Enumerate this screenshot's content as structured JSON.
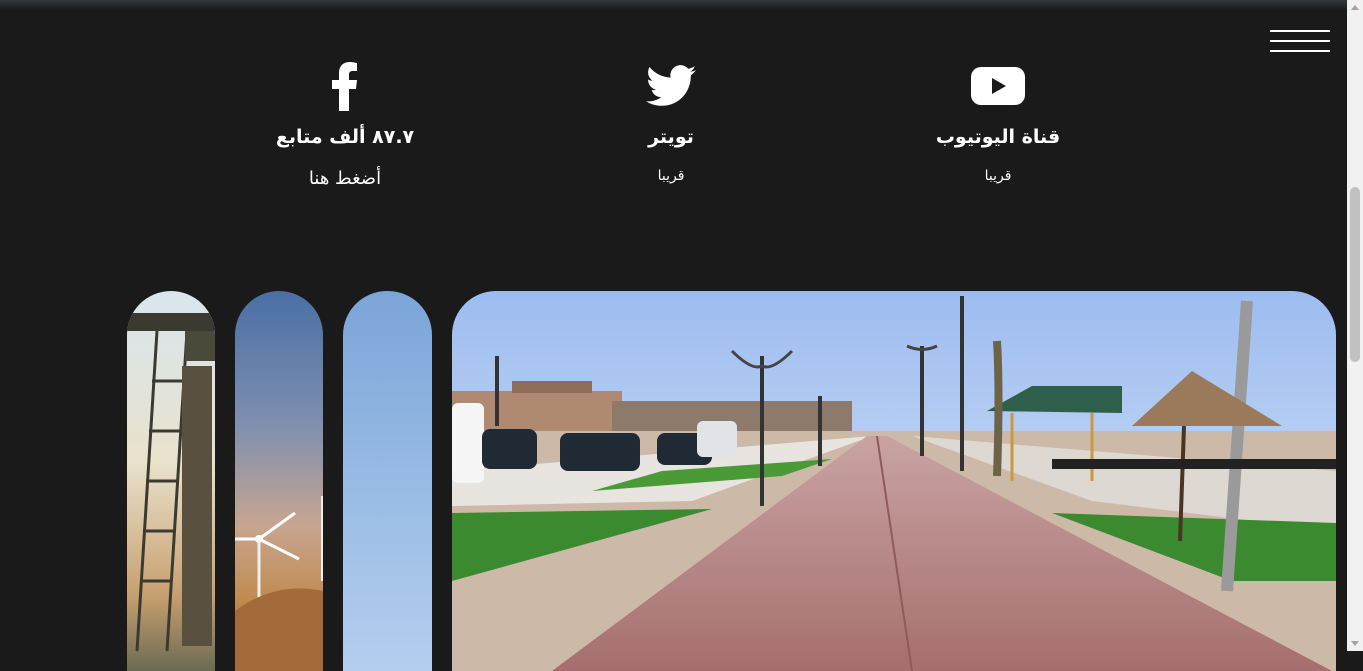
{
  "header": {
    "menu_icon": "hamburger-menu-icon"
  },
  "social": [
    {
      "platform": "facebook",
      "icon": "facebook-icon",
      "title": "٨٧.٧ ألف متابع",
      "link": "أضغط هنا"
    },
    {
      "platform": "twitter",
      "icon": "twitter-icon",
      "title": "تويتر",
      "status": "قريبا"
    },
    {
      "platform": "youtube",
      "icon": "youtube-icon",
      "title": "قناة اليوتيوب",
      "status": "قريبا"
    }
  ],
  "gallery": {
    "main_image": "beach-promenade-photo",
    "thumbnails": [
      "oil-derrick-photo",
      "wind-turbine-photo",
      "sky-photo"
    ]
  },
  "colors": {
    "background": "#1a1a1a",
    "text": "#ffffff"
  }
}
